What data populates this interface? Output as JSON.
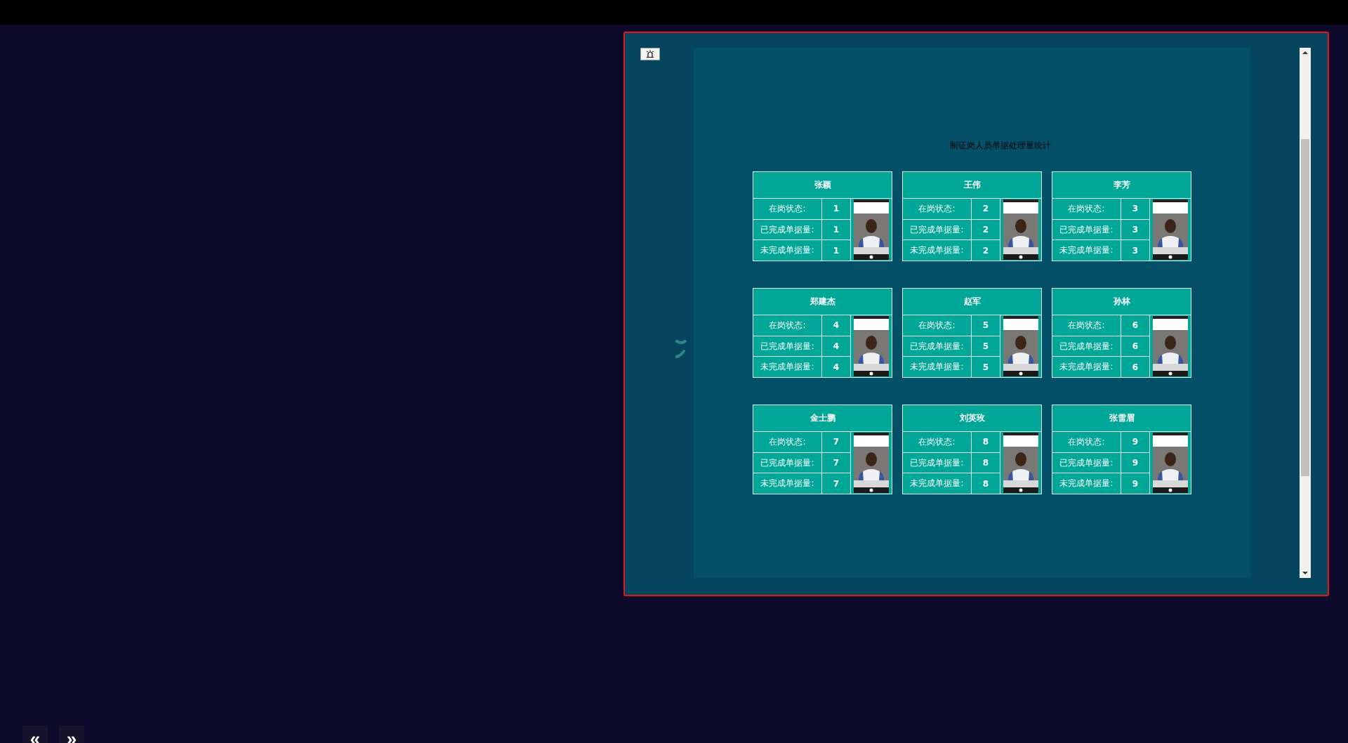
{
  "panel": {
    "title": "制证岗人员单据处理量统计",
    "cards": [
      {
        "name": "张颖",
        "rows": [
          {
            "label": "在岗状态:",
            "value": "1"
          },
          {
            "label": "已完成单据量:",
            "value": "1"
          },
          {
            "label": "未完成单据量:",
            "value": "1"
          }
        ]
      },
      {
        "name": "王伟",
        "rows": [
          {
            "label": "在岗状态:",
            "value": "2"
          },
          {
            "label": "已完成单据量:",
            "value": "2"
          },
          {
            "label": "未完成单据量:",
            "value": "2"
          }
        ]
      },
      {
        "name": "李芳",
        "rows": [
          {
            "label": "在岗状态:",
            "value": "3"
          },
          {
            "label": "已完成单据量:",
            "value": "3"
          },
          {
            "label": "未完成单据量:",
            "value": "3"
          }
        ]
      },
      {
        "name": "郑建杰",
        "rows": [
          {
            "label": "在岗状态:",
            "value": "4"
          },
          {
            "label": "已完成单据量:",
            "value": "4"
          },
          {
            "label": "未完成单据量:",
            "value": "4"
          }
        ]
      },
      {
        "name": "赵军",
        "rows": [
          {
            "label": "在岗状态:",
            "value": "5"
          },
          {
            "label": "已完成单据量:",
            "value": "5"
          },
          {
            "label": "未完成单据量:",
            "value": "5"
          }
        ]
      },
      {
        "name": "孙林",
        "rows": [
          {
            "label": "在岗状态:",
            "value": "6"
          },
          {
            "label": "已完成单据量:",
            "value": "6"
          },
          {
            "label": "未完成单据量:",
            "value": "6"
          }
        ]
      },
      {
        "name": "金士鹏",
        "rows": [
          {
            "label": "在岗状态:",
            "value": "7"
          },
          {
            "label": "已完成单据量:",
            "value": "7"
          },
          {
            "label": "未完成单据量:",
            "value": "7"
          }
        ]
      },
      {
        "name": "刘英玫",
        "rows": [
          {
            "label": "在岗状态:",
            "value": "8"
          },
          {
            "label": "已完成单据量:",
            "value": "8"
          },
          {
            "label": "未完成单据量:",
            "value": "8"
          }
        ]
      },
      {
        "name": "张雪眉",
        "rows": [
          {
            "label": "在岗状态:",
            "value": "9"
          },
          {
            "label": "已完成单据量:",
            "value": "9"
          },
          {
            "label": "未完成单据量:",
            "value": "9"
          }
        ]
      }
    ]
  },
  "pager": {
    "prev": "«",
    "next": "»"
  }
}
